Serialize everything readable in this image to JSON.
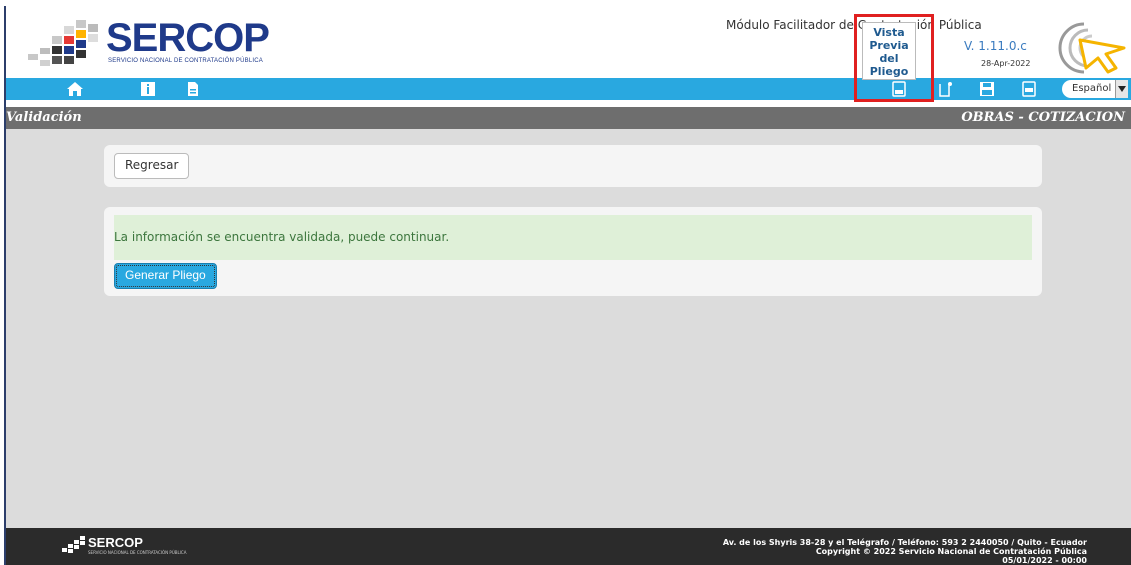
{
  "header": {
    "logo_text": "SERCOP",
    "logo_subtitle": "SERVICIO NACIONAL DE CONTRATACIÓN PÚBLICA",
    "module_title": "Módulo Facilitador de Contratación Pública",
    "version": "V. 1.11.0.c",
    "date": "28-Apr-2022",
    "tooltip_lines": [
      "Vista",
      "Previa",
      "del",
      "Pliego"
    ]
  },
  "toolbar": {
    "language": "Español"
  },
  "titlebar": {
    "left": "Validación",
    "right": "OBRAS - COTIZACION"
  },
  "main": {
    "back_label": "Regresar",
    "alert_text": "La información se encuentra validada, puede continuar.",
    "generate_label": "Generar Pliego"
  },
  "footer": {
    "logo_text": "SERCOP",
    "logo_subtitle": "SERVICIO NACIONAL DE CONTRATACIÓN PÚBLICA",
    "address": "Av. de los Shyris 38-28 y el Telégrafo / Teléfono: 593 2 2440050 / Quito - Ecuador",
    "copyright": "Copyright © 2022 Servicio Nacional de Contratación Pública",
    "timestamp": "05/01/2022 - 00:00"
  },
  "colors": {
    "toolbar": "#29a8e0",
    "titlebar": "#6e6e6e",
    "alert_bg": "#dff0d8",
    "alert_text": "#3c763d",
    "brand": "#1f3a8a",
    "highlight": "#e02020"
  }
}
